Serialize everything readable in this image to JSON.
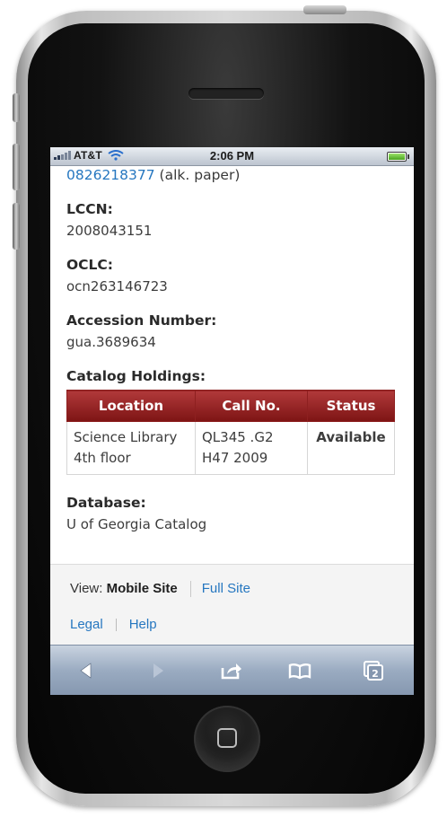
{
  "status_bar": {
    "carrier": "AT&T",
    "time": "2:06 PM",
    "signal_icon": "signal-bars-icon",
    "wifi_icon": "wifi-icon",
    "battery_icon": "battery-icon"
  },
  "record": {
    "isbn_link": "0826218377",
    "isbn_note": " (alk. paper)",
    "lccn": {
      "label": "LCCN:",
      "value": "2008043151"
    },
    "oclc": {
      "label": "OCLC:",
      "value": "ocn263146723"
    },
    "accession": {
      "label": "Accession Number:",
      "value": "gua.3689634"
    },
    "holdings": {
      "label": "Catalog Holdings:",
      "columns": [
        "Location",
        "Call No.",
        "Status"
      ],
      "rows": [
        {
          "location_line1": "Science Library",
          "location_line2": "4th floor",
          "call_line1": "QL345 .G2",
          "call_line2": "H47 2009",
          "status": "Available"
        }
      ]
    },
    "database": {
      "label": "Database:",
      "value": "U of Georgia Catalog"
    }
  },
  "footer": {
    "view_prefix": "View: ",
    "mobile_site": "Mobile Site",
    "full_site": "Full Site",
    "legal": "Legal",
    "help": "Help"
  },
  "toolbar": {
    "items": [
      "back-arrow-icon",
      "forward-arrow-icon",
      "share-icon",
      "bookmarks-icon",
      "tabs-icon"
    ],
    "tabs_count": "2"
  },
  "colors": {
    "link": "#2677c0",
    "table_header": "#9b2626",
    "toolbar": "#9aabc1"
  }
}
